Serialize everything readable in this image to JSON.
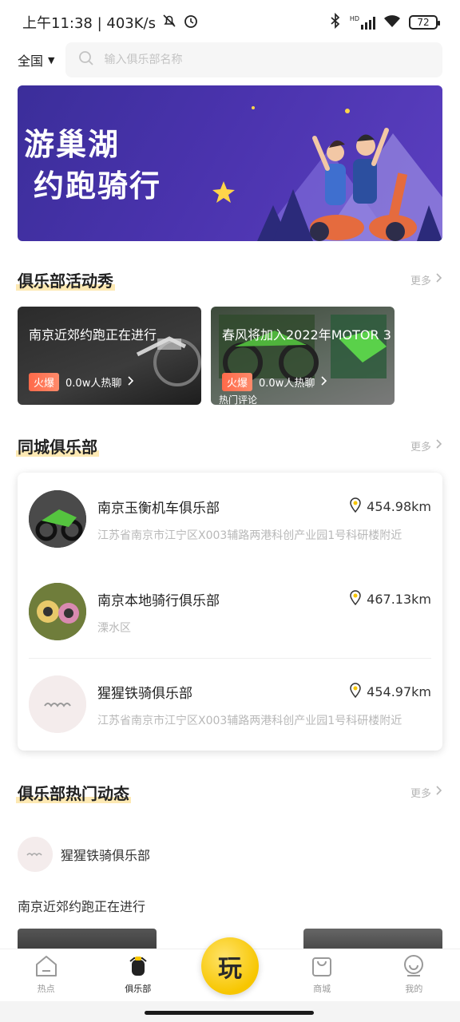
{
  "status_bar": {
    "time_speed": "上午11:38 | 403K/s",
    "network": "HD",
    "battery": "72"
  },
  "top_bar": {
    "region": "全国",
    "search_placeholder": "输入俱乐部名称"
  },
  "banner": {
    "line1": "游巢湖",
    "line2": "约跑骑行"
  },
  "activity_section": {
    "title": "俱乐部活动秀",
    "more": "更多",
    "cards": [
      {
        "title": "南京近郊约跑正在进行",
        "tag": "火爆",
        "chat": "0.0w人热聊",
        "extra": ""
      },
      {
        "title": "春风将加入2022年MOTOR 3",
        "tag": "火爆",
        "chat": "0.0w人热聊",
        "extra": "热门评论"
      }
    ]
  },
  "clubs_section": {
    "title": "同城俱乐部",
    "more": "更多",
    "clubs": [
      {
        "name": "南京玉衡机车俱乐部",
        "distance": "454.98km",
        "address": "江苏省南京市江宁区X003辅路两港科创产业园1号科研楼附近"
      },
      {
        "name": "南京本地骑行俱乐部",
        "distance": "467.13km",
        "address": "溧水区"
      },
      {
        "name": "猩猩铁骑俱乐部",
        "distance": "454.97km",
        "address": "江苏省南京市江宁区X003辅路两港科创产业园1号科研楼附近"
      }
    ]
  },
  "feed_section": {
    "title": "俱乐部热门动态",
    "more": "更多",
    "user": "猩猩铁骑俱乐部",
    "post_text": "南京近郊约跑正在进行"
  },
  "bottom_nav": {
    "items": [
      {
        "label": "热点",
        "icon": "hot-icon"
      },
      {
        "label": "俱乐部",
        "icon": "club-icon"
      },
      {
        "label": "商城",
        "icon": "shop-icon"
      },
      {
        "label": "我的",
        "icon": "profile-icon"
      }
    ],
    "center": "玩",
    "active": "俱乐部"
  },
  "colors": {
    "accent": "#f7c600",
    "highlight": "#fde9b3",
    "hot_tag": "#ff6a4a",
    "banner": "#4a33ad"
  }
}
